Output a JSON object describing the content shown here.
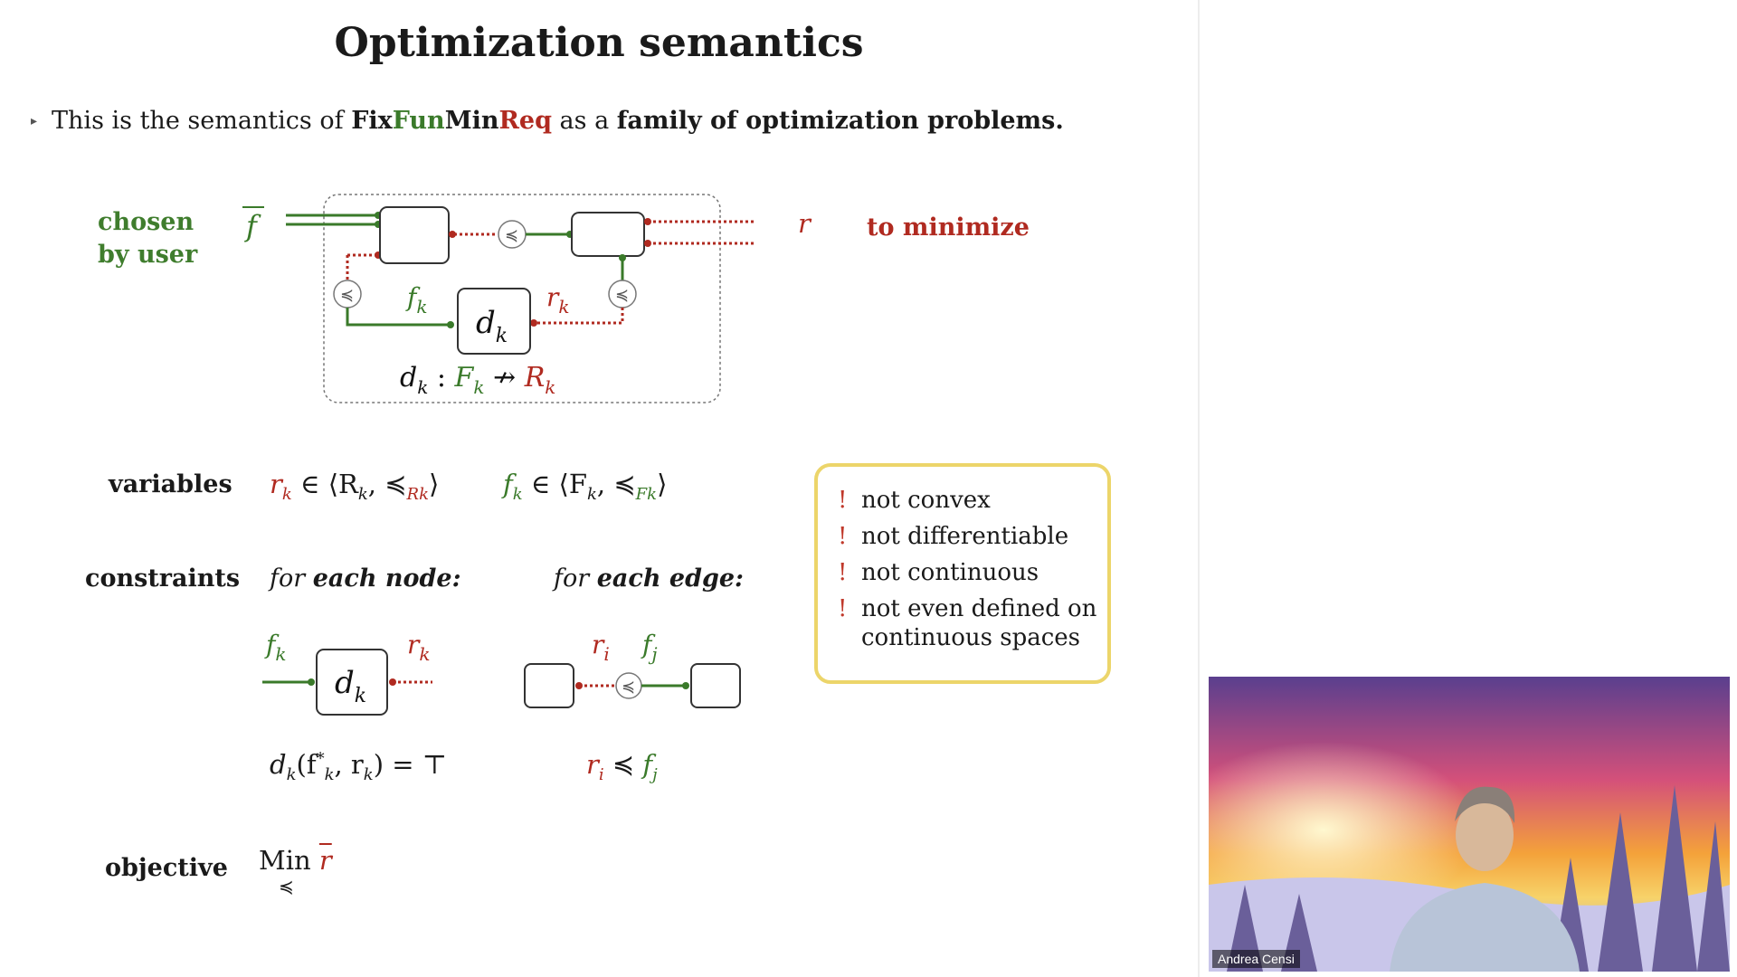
{
  "slide": {
    "title": "Optimization semantics",
    "bullet": {
      "prefix": "This is the semantics of ",
      "fix": "Fix",
      "fun": "Fun",
      "min": "Min",
      "req": "Req",
      "middle": " as a ",
      "emphasis": "family of optimization problems."
    },
    "diagram": {
      "chosen_label_1": "chosen",
      "chosen_label_2": "by user",
      "f_bar": "f",
      "r_bar": "r",
      "minimize_label": "to minimize",
      "fk": "f",
      "rk": "r",
      "dk": "d",
      "sub_k": "k",
      "signature": {
        "d": "d",
        "colon": " : ",
        "F": "F",
        "arrow": " ↛ ",
        "R": "R"
      }
    },
    "variables": {
      "label": "variables",
      "r_expr": "r",
      "r_in": " ∈ ⟨R",
      "r_order": ", ≼",
      "r_sub": "R",
      "f_expr": "f",
      "f_in": " ∈ ⟨F",
      "f_order": ", ≼",
      "f_sub": "F",
      "close": "⟩"
    },
    "constraints": {
      "label": "constraints",
      "node_header_pre": "for ",
      "node_header_bold": "each node:",
      "edge_header_pre": "for ",
      "edge_header_bold": "each edge:",
      "node_equation": "d",
      "node_eq_body": "(f",
      "node_eq_star": "*",
      "node_eq_mid": ", r",
      "node_eq_end": ") = ⊤",
      "edge_ri": "r",
      "edge_i": "i",
      "edge_leq": " ≼ ",
      "edge_fj": "f",
      "edge_j": "j"
    },
    "objective": {
      "label": "objective",
      "min": "Min",
      "under": "≼",
      "r": "r"
    },
    "notes": [
      {
        "mark": "!",
        "text": "not convex"
      },
      {
        "mark": "!",
        "text": "not differentiable"
      },
      {
        "mark": "!",
        "text": "not continuous"
      },
      {
        "mark": "!",
        "text": "not even defined on"
      },
      {
        "mark": "",
        "text": "continuous spaces"
      }
    ],
    "colors": {
      "green": "#3a7a2a",
      "red": "#b02a20",
      "note_border": "#ecd56a"
    }
  },
  "video": {
    "speaker_name": "Andrea Censi"
  }
}
